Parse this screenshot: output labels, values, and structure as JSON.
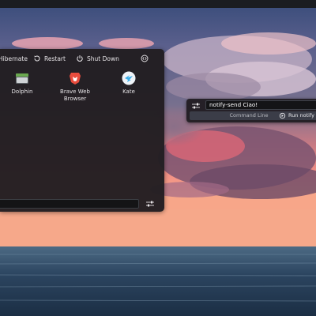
{
  "power": {
    "hibernate": "Hibernate",
    "restart": "Restart",
    "shutdown": "Shut Down"
  },
  "apps": [
    {
      "name": "Dolphin",
      "icon": "dolphin-folder-icon"
    },
    {
      "name": "Brave Web\nBrowser",
      "icon": "brave-lion-icon"
    },
    {
      "name": "Kate",
      "icon": "kate-bird-icon"
    }
  ],
  "krunner": {
    "query": "notify-send Ciao!",
    "category": "Command Line",
    "action": "Run notify"
  },
  "colors": {
    "panel": "#221e22",
    "accent": "#3daee9",
    "brave": "#e84c3d"
  }
}
